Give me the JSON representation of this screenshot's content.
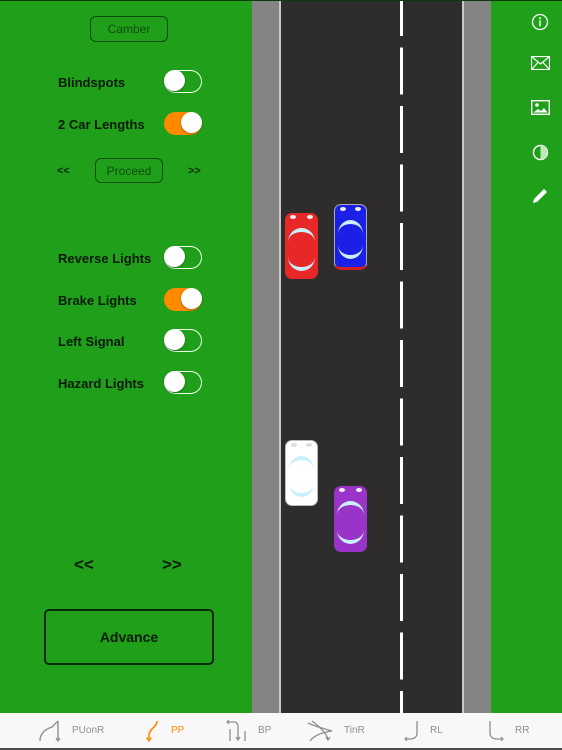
{
  "left_panel": {
    "camber_label": "Camber",
    "toggles_top": [
      {
        "label": "Blindspots",
        "on": false
      },
      {
        "label": "2 Car Lengths",
        "on": true
      }
    ],
    "proceed": {
      "prev_label": "<<",
      "button_label": "Proceed",
      "next_label": ">>"
    },
    "toggles_lights": [
      {
        "label": "Reverse Lights",
        "on": false
      },
      {
        "label": "Brake Lights",
        "on": true
      },
      {
        "label": "Left Signal",
        "on": false
      },
      {
        "label": "Hazard Lights",
        "on": false
      }
    ],
    "nav": {
      "prev_label": "<<",
      "next_label": ">>"
    },
    "advance_label": "Advance"
  },
  "road": {
    "cars": [
      {
        "name": "red-car",
        "color": "#e82828"
      },
      {
        "name": "blue-car",
        "color": "#1c20e6"
      },
      {
        "name": "white-car",
        "color": "#ffffff"
      },
      {
        "name": "purple-car",
        "color": "#9a34c8"
      }
    ]
  },
  "side_icons": [
    "info-icon",
    "mail-icon",
    "image-icon",
    "contrast-icon",
    "pencil-icon"
  ],
  "tabbar": {
    "tabs": [
      {
        "label": "PUonR",
        "icon": "pull-up-on-right-icon",
        "active": false
      },
      {
        "label": "PP",
        "icon": "parallel-park-icon",
        "active": true
      },
      {
        "label": "BP",
        "icon": "bay-park-icon",
        "active": false
      },
      {
        "label": "TinR",
        "icon": "turn-in-road-icon",
        "active": false
      },
      {
        "label": "RL",
        "icon": "reverse-left-icon",
        "active": false
      },
      {
        "label": "RR",
        "icon": "reverse-right-icon",
        "active": false
      }
    ]
  },
  "colors": {
    "accent": "#ff8a00",
    "background_green": "#20a01a",
    "asphalt": "#2e2c2d",
    "curb": "#868383"
  }
}
